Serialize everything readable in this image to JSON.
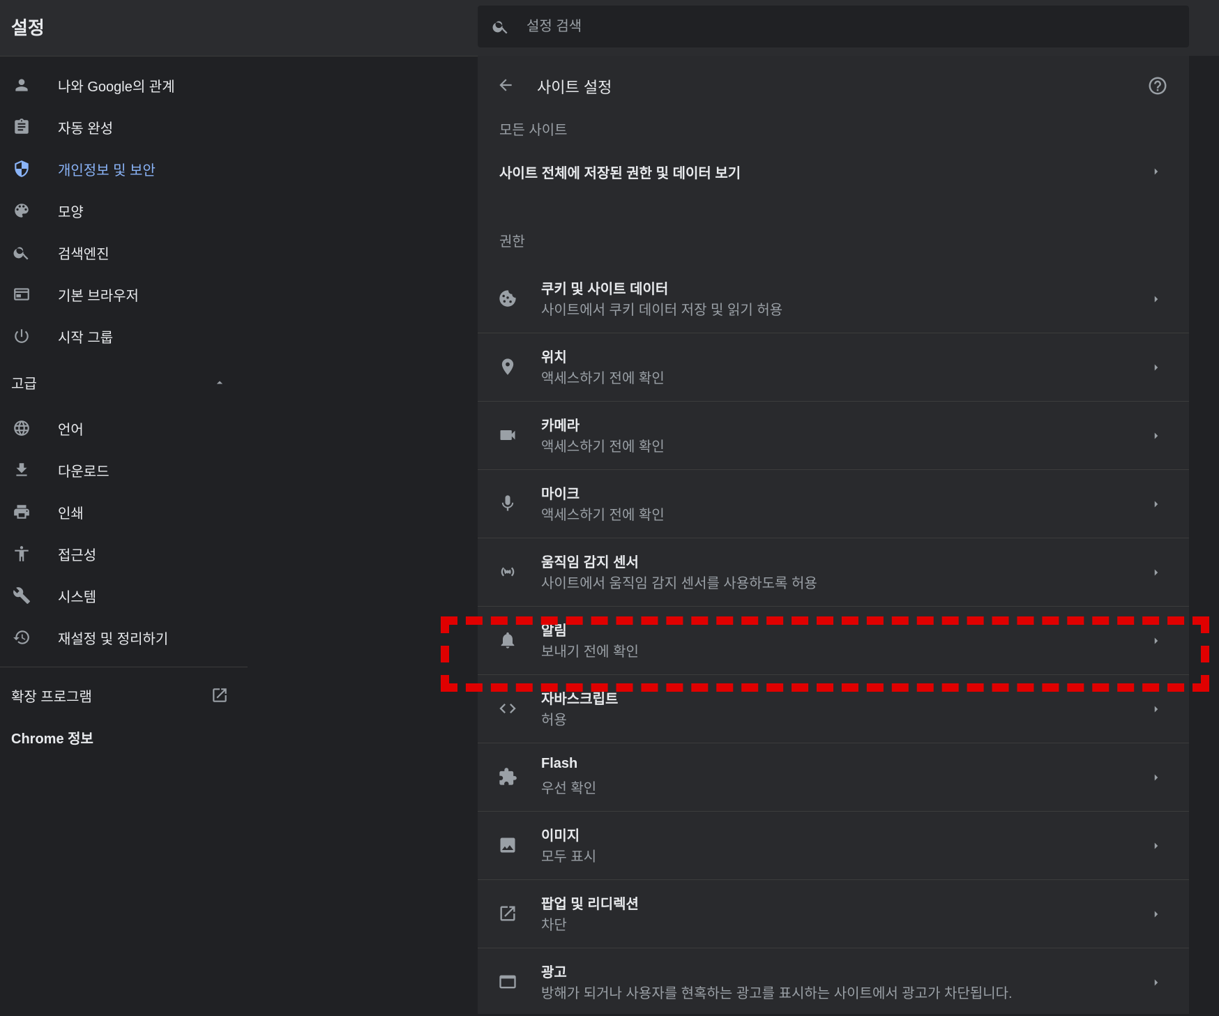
{
  "app": {
    "title": "설정"
  },
  "search": {
    "placeholder": "설정 검색",
    "value": ""
  },
  "sidebar": {
    "items": [
      {
        "label": "나와 Google의 관계",
        "icon": "person-icon"
      },
      {
        "label": "자동 완성",
        "icon": "clipboard-icon"
      },
      {
        "label": "개인정보 및 보안",
        "icon": "shield-icon",
        "active": true
      },
      {
        "label": "모양",
        "icon": "palette-icon"
      },
      {
        "label": "검색엔진",
        "icon": "search-icon"
      },
      {
        "label": "기본 브라우저",
        "icon": "browser-icon"
      },
      {
        "label": "시작 그룹",
        "icon": "power-icon"
      }
    ],
    "advanced": {
      "label": "고급",
      "items": [
        {
          "label": "언어",
          "icon": "globe-icon"
        },
        {
          "label": "다운로드",
          "icon": "download-icon"
        },
        {
          "label": "인쇄",
          "icon": "print-icon"
        },
        {
          "label": "접근성",
          "icon": "accessibility-icon"
        },
        {
          "label": "시스템",
          "icon": "wrench-icon"
        },
        {
          "label": "재설정 및 정리하기",
          "icon": "restore-icon"
        }
      ]
    },
    "extensions_label": "확장 프로그램",
    "about_label": "Chrome 정보"
  },
  "main": {
    "title": "사이트 설정",
    "all_sites_header": "모든 사이트",
    "all_sites_link": "사이트 전체에 저장된 권한 및 데이터 보기",
    "permissions_header": "권한",
    "permissions": [
      {
        "title": "쿠키 및 사이트 데이터",
        "subtitle": "사이트에서 쿠키 데이터 저장 및 읽기 허용",
        "icon": "cookie-icon"
      },
      {
        "title": "위치",
        "subtitle": "액세스하기 전에 확인",
        "icon": "location-icon"
      },
      {
        "title": "카메라",
        "subtitle": "액세스하기 전에 확인",
        "icon": "camera-icon"
      },
      {
        "title": "마이크",
        "subtitle": "액세스하기 전에 확인",
        "icon": "microphone-icon"
      },
      {
        "title": "움직임 감지 센서",
        "subtitle": "사이트에서 움직임 감지 센서를 사용하도록 허용",
        "icon": "sensor-icon"
      },
      {
        "title": "알림",
        "subtitle": "보내기 전에 확인",
        "icon": "bell-icon"
      },
      {
        "title": "자바스크립트",
        "subtitle": "허용",
        "icon": "code-icon"
      },
      {
        "title": "Flash",
        "subtitle": "우선 확인",
        "icon": "puzzle-icon"
      },
      {
        "title": "이미지",
        "subtitle": "모두 표시",
        "icon": "image-icon"
      },
      {
        "title": "팝업 및 리디렉션",
        "subtitle": "차단",
        "icon": "open-in-new-icon"
      },
      {
        "title": "광고",
        "subtitle": "방해가 되거나 사용자를 현혹하는 광고를 표시하는 사이트에서 광고가 차단됩니다.",
        "icon": "ads-icon"
      }
    ]
  },
  "colors": {
    "background": "#202124",
    "panel": "#292a2d",
    "accent": "#8ab4f8",
    "highlight": "#e00000"
  }
}
